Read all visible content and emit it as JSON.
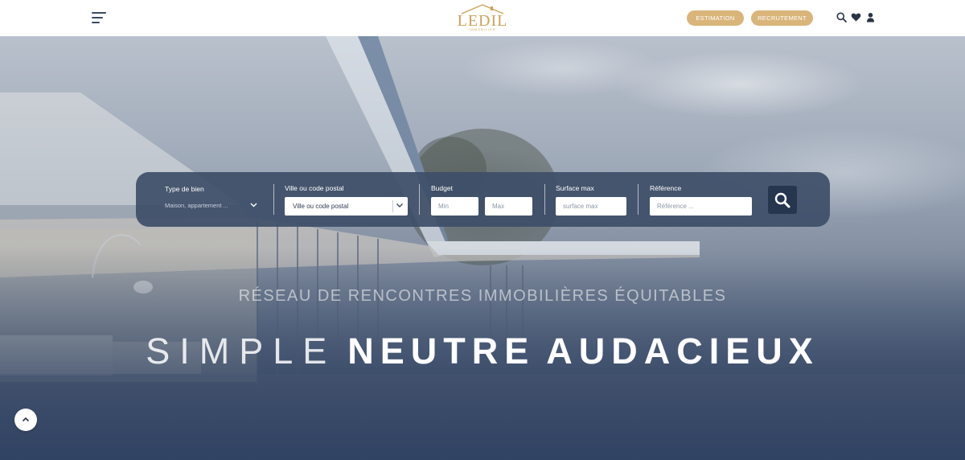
{
  "header": {
    "menu_icon": "hamburger-menu-icon",
    "logo_text": "LEDIL",
    "logo_subtext": "IMMOBILIER",
    "estimation_label": "ESTIMATION",
    "recrutement_label": "RECRUTEMENT",
    "icons": [
      "search-icon",
      "heart-icon",
      "user-icon"
    ],
    "accent_color": "#d9b57a",
    "logo_color": "#caa35b"
  },
  "search": {
    "type_label": "Type de bien",
    "type_value": "Maison, appartement ...",
    "ville_label": "Ville ou code postal",
    "ville_value": "Ville ou code postal",
    "budget_label": "Budget",
    "budget_min_placeholder": "Min",
    "budget_max_placeholder": "Max",
    "surface_label": "Surface max",
    "surface_placeholder": "surface max",
    "reference_label": "Référence",
    "reference_placeholder": "Référence ...",
    "submit_icon": "search-icon",
    "panel_color": "#3e4e68",
    "button_color": "#26364f"
  },
  "hero": {
    "tagline": "RÉSEAU DE RENCONTRES IMMOBILIÈRES ÉQUITABLES",
    "word1": "SIMPLE",
    "word2": "NEUTRE",
    "word3": "AUDACIEUX"
  },
  "scroll_top_icon": "chevron-up-icon"
}
